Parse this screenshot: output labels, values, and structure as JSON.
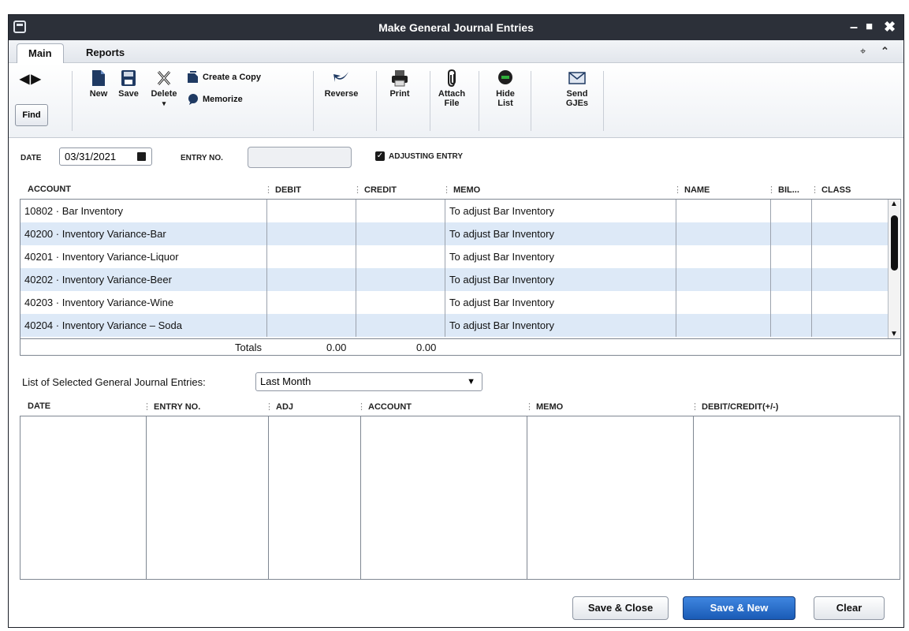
{
  "window": {
    "title": "Make General Journal Entries"
  },
  "tabs": [
    {
      "label": "Main"
    },
    {
      "label": "Reports"
    }
  ],
  "toolbar": {
    "find": "Find",
    "new": "New",
    "save": "Save",
    "delete": "Delete",
    "create_copy": "Create a Copy",
    "memorize": "Memorize",
    "reverse": "Reverse",
    "print": "Print",
    "attach_file": [
      "Attach",
      "File"
    ],
    "hide_list": [
      "Hide",
      "List"
    ],
    "send_gjes": [
      "Send",
      "GJEs"
    ]
  },
  "form": {
    "date_label": "DATE",
    "date_value": "03/31/2021",
    "entry_no_label": "ENTRY NO.",
    "entry_no_value": "",
    "adjusting_label": "ADJUSTING ENTRY",
    "adjusting_checked": true
  },
  "entries_table": {
    "columns": [
      "ACCOUNT",
      "DEBIT",
      "CREDIT",
      "MEMO",
      "NAME",
      "BIL...",
      "CLASS"
    ],
    "rows": [
      {
        "account": "10802 · Bar Inventory",
        "debit": "",
        "credit": "",
        "memo": "To adjust Bar Inventory",
        "name": "",
        "billable": "",
        "class": ""
      },
      {
        "account": "40200 · Inventory Variance-Bar",
        "debit": "",
        "credit": "",
        "memo": "To adjust Bar Inventory",
        "name": "",
        "billable": "",
        "class": ""
      },
      {
        "account": "40201 · Inventory Variance-Liquor",
        "debit": "",
        "credit": "",
        "memo": "To adjust Bar Inventory",
        "name": "",
        "billable": "",
        "class": ""
      },
      {
        "account": "40202 · Inventory Variance-Beer",
        "debit": "",
        "credit": "",
        "memo": "To adjust Bar Inventory",
        "name": "",
        "billable": "",
        "class": ""
      },
      {
        "account": "40203 · Inventory Variance-Wine",
        "debit": "",
        "credit": "",
        "memo": "To adjust Bar Inventory",
        "name": "",
        "billable": "",
        "class": ""
      },
      {
        "account": "40204 · Inventory Variance – Soda",
        "debit": "",
        "credit": "",
        "memo": "To adjust Bar Inventory",
        "name": "",
        "billable": "",
        "class": ""
      }
    ],
    "totals_label": "Totals",
    "total_debit": "0.00",
    "total_credit": "0.00"
  },
  "list": {
    "label": "List of Selected General Journal Entries:",
    "filter_value": "Last Month",
    "columns": [
      "DATE",
      "ENTRY NO.",
      "ADJ",
      "ACCOUNT",
      "MEMO",
      "DEBIT/CREDIT(+/-)"
    ]
  },
  "footer": {
    "save_close": "Save & Close",
    "save_new": "Save & New",
    "clear": "Clear"
  },
  "colors": {
    "titlebar": "#2c3039",
    "row_alt": "#dde9f7",
    "primary_button": "#1a5bb6"
  }
}
